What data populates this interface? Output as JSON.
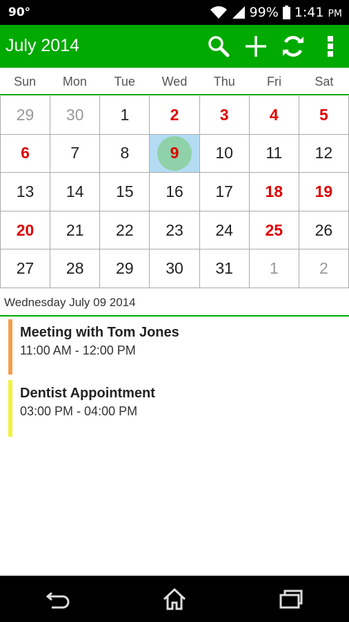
{
  "status_bar": {
    "left_text": "90°",
    "battery": "99%",
    "time": "1:41",
    "ampm": "PM"
  },
  "app_bar": {
    "title": "July 2014",
    "actions": [
      "search-icon",
      "add-icon",
      "refresh-icon",
      "overflow-menu-icon"
    ]
  },
  "weekdays": [
    "Sun",
    "Mon",
    "Tue",
    "Wed",
    "Thu",
    "Fri",
    "Sat"
  ],
  "calendar": {
    "weeks": [
      [
        {
          "d": "29",
          "t": "other"
        },
        {
          "d": "30",
          "t": "other"
        },
        {
          "d": "1",
          "t": "normal"
        },
        {
          "d": "2",
          "t": "holiday"
        },
        {
          "d": "3",
          "t": "holiday"
        },
        {
          "d": "4",
          "t": "holiday"
        },
        {
          "d": "5",
          "t": "holiday"
        }
      ],
      [
        {
          "d": "6",
          "t": "holiday"
        },
        {
          "d": "7",
          "t": "normal"
        },
        {
          "d": "8",
          "t": "normal"
        },
        {
          "d": "9",
          "t": "selected"
        },
        {
          "d": "10",
          "t": "normal"
        },
        {
          "d": "11",
          "t": "normal"
        },
        {
          "d": "12",
          "t": "normal"
        }
      ],
      [
        {
          "d": "13",
          "t": "normal"
        },
        {
          "d": "14",
          "t": "normal"
        },
        {
          "d": "15",
          "t": "normal"
        },
        {
          "d": "16",
          "t": "normal"
        },
        {
          "d": "17",
          "t": "normal"
        },
        {
          "d": "18",
          "t": "holiday"
        },
        {
          "d": "19",
          "t": "holiday"
        }
      ],
      [
        {
          "d": "20",
          "t": "holiday"
        },
        {
          "d": "21",
          "t": "normal"
        },
        {
          "d": "22",
          "t": "normal"
        },
        {
          "d": "23",
          "t": "normal"
        },
        {
          "d": "24",
          "t": "normal"
        },
        {
          "d": "25",
          "t": "holiday"
        },
        {
          "d": "26",
          "t": "normal"
        }
      ],
      [
        {
          "d": "27",
          "t": "normal"
        },
        {
          "d": "28",
          "t": "normal"
        },
        {
          "d": "29",
          "t": "normal"
        },
        {
          "d": "30",
          "t": "normal"
        },
        {
          "d": "31",
          "t": "normal"
        },
        {
          "d": "1",
          "t": "other"
        },
        {
          "d": "2",
          "t": "other"
        }
      ]
    ]
  },
  "selected_date_label": "Wednesday July 09 2014",
  "events": [
    {
      "title": "Meeting with Tom Jones",
      "time": "11:00 AM - 12:00 PM",
      "color": "#f5a04a"
    },
    {
      "title": "Dentist Appointment",
      "time": "03:00 PM - 04:00 PM",
      "color": "#f2f23a"
    }
  ],
  "colors": {
    "accent": "#00aa00",
    "holiday": "#e00000",
    "selected_bg": "#b3dcf3",
    "today_circle": "#8fd1a8"
  },
  "nav_bar": [
    "back-icon",
    "home-icon",
    "recents-icon"
  ]
}
